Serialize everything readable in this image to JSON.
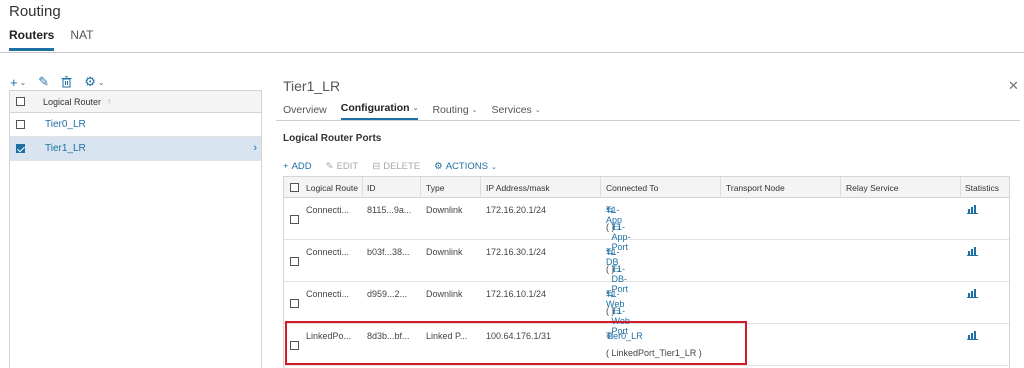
{
  "page": {
    "title": "Routing",
    "tabs": [
      {
        "label": "Routers",
        "active": true
      },
      {
        "label": "NAT",
        "active": false
      }
    ]
  },
  "left": {
    "toolbar": [
      {
        "icon": "plus-icon",
        "glyph": "+",
        "has_caret": true
      },
      {
        "icon": "pencil-icon",
        "glyph": "✎",
        "has_caret": false
      },
      {
        "icon": "trash-icon",
        "glyph": "🗑",
        "has_caret": false
      },
      {
        "icon": "gear-icon",
        "glyph": "⚙",
        "has_caret": true
      }
    ],
    "header_label": "Logical Router",
    "sort_glyph": "↑",
    "rows": [
      {
        "label": "Tier0_LR",
        "selected": false
      },
      {
        "label": "Tier1_LR",
        "selected": true
      }
    ]
  },
  "detail": {
    "title": "Tier1_LR",
    "tabs": [
      {
        "label": "Overview",
        "active": false,
        "caret": false
      },
      {
        "label": "Configuration",
        "active": true,
        "caret": true
      },
      {
        "label": "Routing",
        "active": false,
        "caret": true
      },
      {
        "label": "Services",
        "active": false,
        "caret": true
      }
    ],
    "section_title": "Logical Router Ports",
    "toolbar": {
      "add": "ADD",
      "edit": "EDIT",
      "delete": "DELETE",
      "actions": "ACTIONS"
    },
    "columns": [
      "Logical Route",
      "ID",
      "Type",
      "IP Address/mask",
      "Connected To",
      "Transport Node",
      "Relay Service",
      "Statistics"
    ],
    "rows": [
      {
        "name": "Connecti...",
        "id": "8115...9a...",
        "type": "Downlink",
        "ip": "172.16.20.1/24",
        "connected_icon": "switch-icon",
        "connected": "T1-App",
        "port": "T1-App-Port"
      },
      {
        "name": "Connecti...",
        "id": "b03f...38...",
        "type": "Downlink",
        "ip": "172.16.30.1/24",
        "connected_icon": "switch-icon",
        "connected": "T1-DB",
        "port": "T1-DB-Port"
      },
      {
        "name": "Connecti...",
        "id": "d959...2...",
        "type": "Downlink",
        "ip": "172.16.10.1/24",
        "connected_icon": "switch-icon",
        "connected": "T1-Web",
        "port": "T1-Web-Port"
      },
      {
        "name": "LinkedPo...",
        "id": "8d3b...bf...",
        "type": "Linked P...",
        "ip": "100.64.176.1/31",
        "connected_icon": "router-icon",
        "connected": "Tier0_LR",
        "port": "( LinkedPort_Tier1_LR )"
      }
    ]
  },
  "colors": {
    "accent": "#1d6fa4",
    "highlight": "#d21b28",
    "selected_row": "#d8e5f0"
  }
}
